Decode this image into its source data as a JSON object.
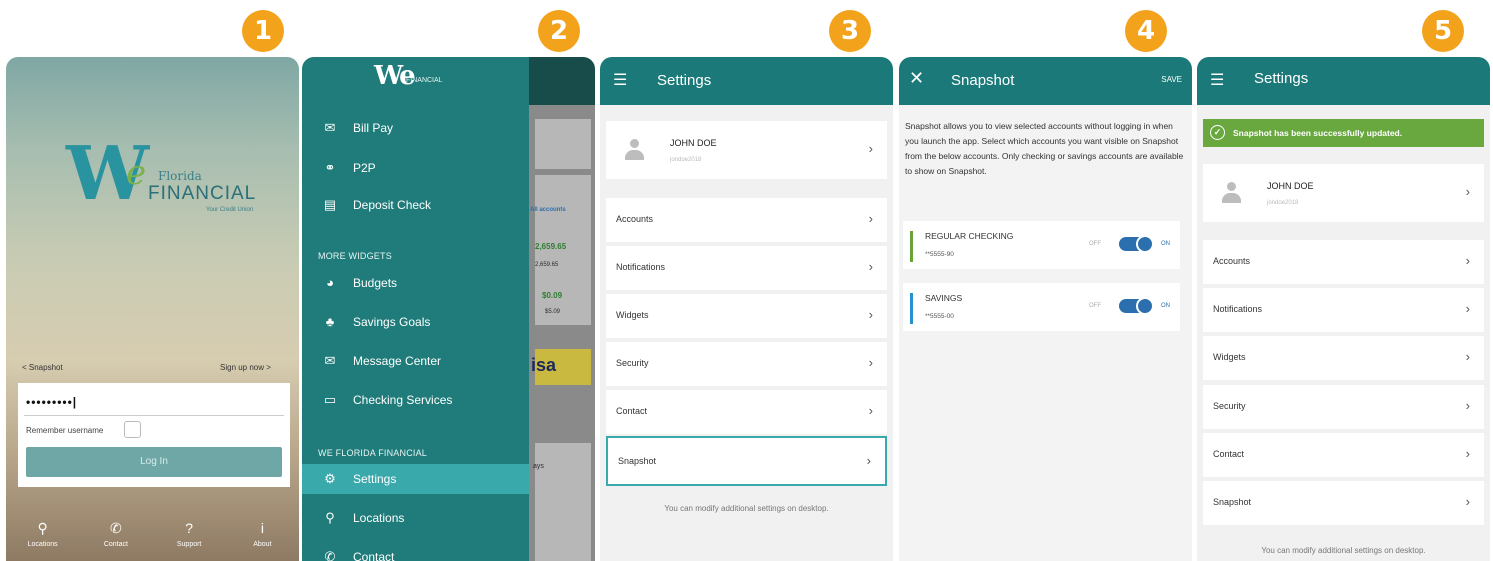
{
  "steps": [
    "1",
    "2",
    "3",
    "4",
    "5"
  ],
  "screen1": {
    "logo": {
      "we": "W",
      "e": "e",
      "florida": "Florida",
      "financial": "FINANCIAL",
      "tagline": "Your Credit Union"
    },
    "snapshot_link": "< Snapshot",
    "signup_link": "Sign up now >",
    "password_value": "•••••••••|",
    "remember_label": "Remember username",
    "login_button": "Log In",
    "bottom_nav": [
      {
        "icon": "location-pin-icon",
        "glyph": "⚲",
        "label": "Locations"
      },
      {
        "icon": "phone-icon",
        "glyph": "✆",
        "label": "Contact"
      },
      {
        "icon": "help-icon",
        "glyph": "?",
        "label": "Support"
      },
      {
        "icon": "info-icon",
        "glyph": "i",
        "label": "About"
      }
    ]
  },
  "screen2": {
    "logo": {
      "we": "We",
      "small": "FINANCIAL"
    },
    "items_top": [
      {
        "icon": "bill-pay-icon",
        "glyph": "✉",
        "label": "Bill Pay"
      },
      {
        "icon": "p2p-icon",
        "glyph": "⚭",
        "label": "P2P"
      },
      {
        "icon": "deposit-check-icon",
        "glyph": "▤",
        "label": "Deposit Check"
      }
    ],
    "section_widgets": "MORE WIDGETS",
    "items_widgets": [
      {
        "icon": "budgets-icon",
        "glyph": "◕",
        "label": "Budgets"
      },
      {
        "icon": "piggy-bank-icon",
        "glyph": "♣",
        "label": "Savings Goals"
      },
      {
        "icon": "message-icon",
        "glyph": "✉",
        "label": "Message Center"
      },
      {
        "icon": "checking-services-icon",
        "glyph": "▭",
        "label": "Checking Services"
      }
    ],
    "section_company": "WE FLORIDA FINANCIAL",
    "items_company": [
      {
        "icon": "gear-icon",
        "glyph": "⚙",
        "label": "Settings"
      },
      {
        "icon": "location-pin-icon",
        "glyph": "⚲",
        "label": "Locations"
      },
      {
        "icon": "phone-icon",
        "glyph": "✆",
        "label": "Contact"
      }
    ],
    "peek": {
      "all_accounts": "All accounts",
      "amount1": "2,659.65",
      "amount1_sub": "2,659.65",
      "amount2": "$0.09",
      "amount2_sub": "$5.09",
      "visa": "isa",
      "days": "ays"
    }
  },
  "screen3": {
    "title": "Settings",
    "user_name": "JOHN DOE",
    "user_id": "jondoe2018",
    "rows": [
      "Accounts",
      "Notifications",
      "Widgets",
      "Security",
      "Contact",
      "Snapshot"
    ],
    "footer": "You can modify additional settings on desktop."
  },
  "screen4": {
    "title": "Snapshot",
    "save": "SAVE",
    "description": "Snapshot allows you to view selected accounts without logging in when you launch the app. Select which accounts you want visible on Snapshot from the below accounts. Only checking or savings accounts are available to show on Snapshot.",
    "accounts": [
      {
        "name": "REGULAR CHECKING",
        "number": "**5555-90",
        "color": "#6aa33a",
        "off": "OFF",
        "on": "ON",
        "enabled": true
      },
      {
        "name": "SAVINGS",
        "number": "**5555-00",
        "color": "#2a8fd0",
        "off": "OFF",
        "on": "ON",
        "enabled": true
      }
    ]
  },
  "screen5": {
    "title": "Settings",
    "success": "Snapshot has been successfully updated.",
    "user_name": "JOHN DOE",
    "user_id": "jondoe2018",
    "rows": [
      "Accounts",
      "Notifications",
      "Widgets",
      "Security",
      "Contact",
      "Snapshot"
    ],
    "footer": "You can modify additional settings on desktop."
  },
  "colors": {
    "accent_orange": "#f3a21b",
    "teal": "#1b7a79",
    "success_green": "#69a83f"
  }
}
